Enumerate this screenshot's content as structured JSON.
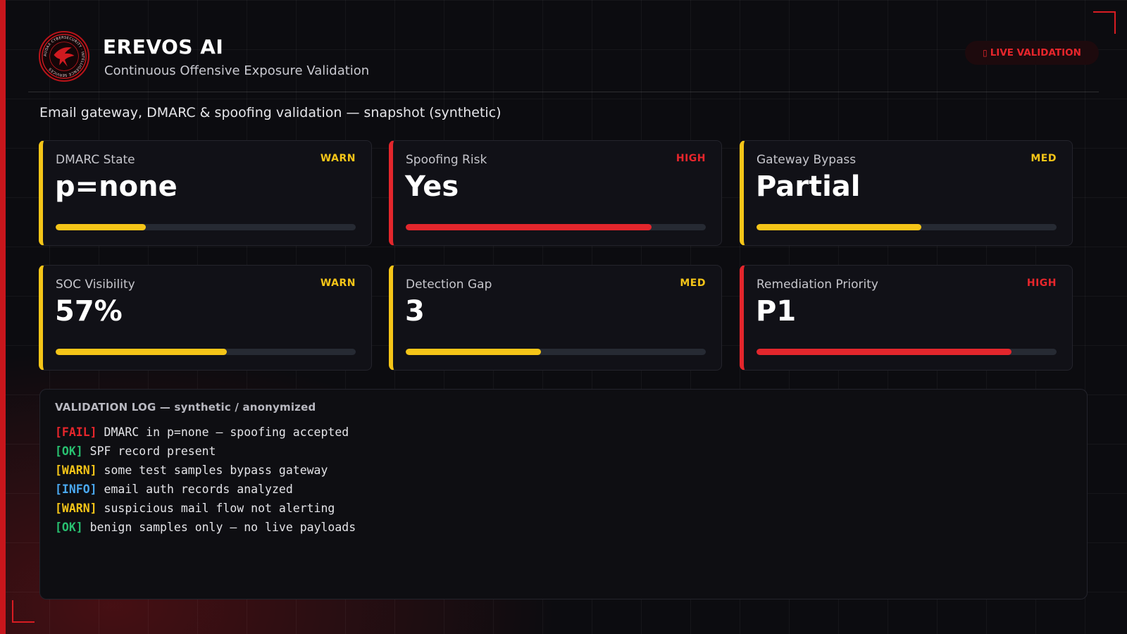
{
  "header": {
    "title": "EREVOS AI",
    "subtitle": "Continuous Offensive Exposure Validation",
    "logo_text": "AUDAX CYBERSECURITY · INTELLIGENCE SERVICES",
    "badge_icon": "▯",
    "badge_label": "LIVE VALIDATION"
  },
  "section_title": "Email gateway, DMARC & spoofing validation — snapshot (synthetic)",
  "colors": {
    "accent_red": "#e3262c",
    "warn_yellow": "#f5c518",
    "ok_green": "#28c070",
    "info_blue": "#4aa8f0",
    "background": "#0c0c10"
  },
  "cards": [
    {
      "label": "DMARC State",
      "status": "WARN",
      "value": "p=none",
      "progress": 0.3
    },
    {
      "label": "Spoofing Risk",
      "status": "HIGH",
      "value": "Yes",
      "progress": 0.82
    },
    {
      "label": "Gateway Bypass",
      "status": "MED",
      "value": "Partial",
      "progress": 0.55
    },
    {
      "label": "SOC Visibility",
      "status": "WARN",
      "value": "57%",
      "progress": 0.57
    },
    {
      "label": "Detection Gap",
      "status": "MED",
      "value": "3",
      "progress": 0.45
    },
    {
      "label": "Remediation Priority",
      "status": "HIGH",
      "value": "P1",
      "progress": 0.85
    }
  ],
  "log": {
    "title": "VALIDATION LOG — synthetic / anonymized",
    "lines": [
      {
        "tag": "[FAIL]",
        "level": "fail",
        "text": " DMARC in p=none — spoofing accepted"
      },
      {
        "tag": "[OK]",
        "level": "ok",
        "text": " SPF record present"
      },
      {
        "tag": "[WARN]",
        "level": "warn",
        "text": " some test samples bypass gateway"
      },
      {
        "tag": "[INFO]",
        "level": "info",
        "text": " email auth records analyzed"
      },
      {
        "tag": "[WARN]",
        "level": "warn",
        "text": " suspicious mail flow not alerting"
      },
      {
        "tag": "[OK]",
        "level": "ok",
        "text": " benign samples only — no live payloads"
      }
    ]
  }
}
